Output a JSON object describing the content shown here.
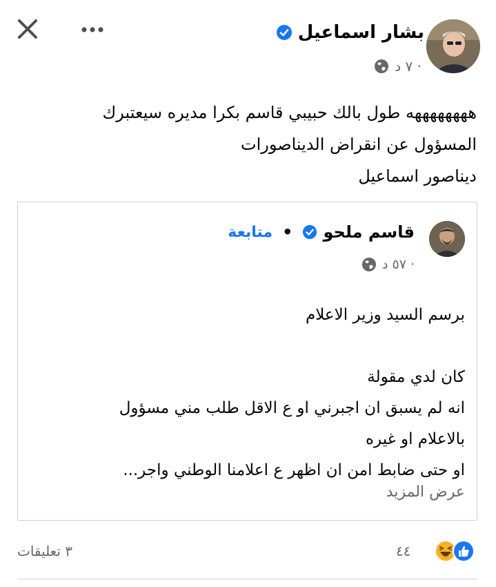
{
  "post": {
    "author_name": "بشار اسماعيل",
    "time": "٧ د ·",
    "text_lines": [
      "ههههههههه طول بالك حبيبي قاسم بكرا مديره سيعتبرك",
      "المسؤول عن انقراض الديناصورات",
      "ديناصور اسماعيل"
    ]
  },
  "shared": {
    "author_name": "قاسم ملحو",
    "separator": "•",
    "follow_label": "متابعة",
    "time": "٥٧ د ·",
    "text_lines": [
      "برسم السيد وزير الاعلام",
      "",
      "كان لدي مقولة",
      "انه لم يسبق ان اجبرني او ع الاقل طلب مني مسؤول",
      "بالاعلام  او غيره",
      "او حتى ضابط امن ان اظهر ع اعلامنا الوطني واجر..."
    ],
    "see_more": "عرض المزيد"
  },
  "footer": {
    "reaction_count": "٤٤",
    "comments": "٣ تعليقات"
  },
  "colors": {
    "accent": "#1877f2",
    "secondary_text": "#65676b",
    "border": "#ced0d4",
    "haha": "#f7b125"
  },
  "icons": [
    "close-icon",
    "more-icon",
    "verified-badge-icon",
    "globe-icon",
    "like-reaction-icon",
    "haha-reaction-icon"
  ]
}
